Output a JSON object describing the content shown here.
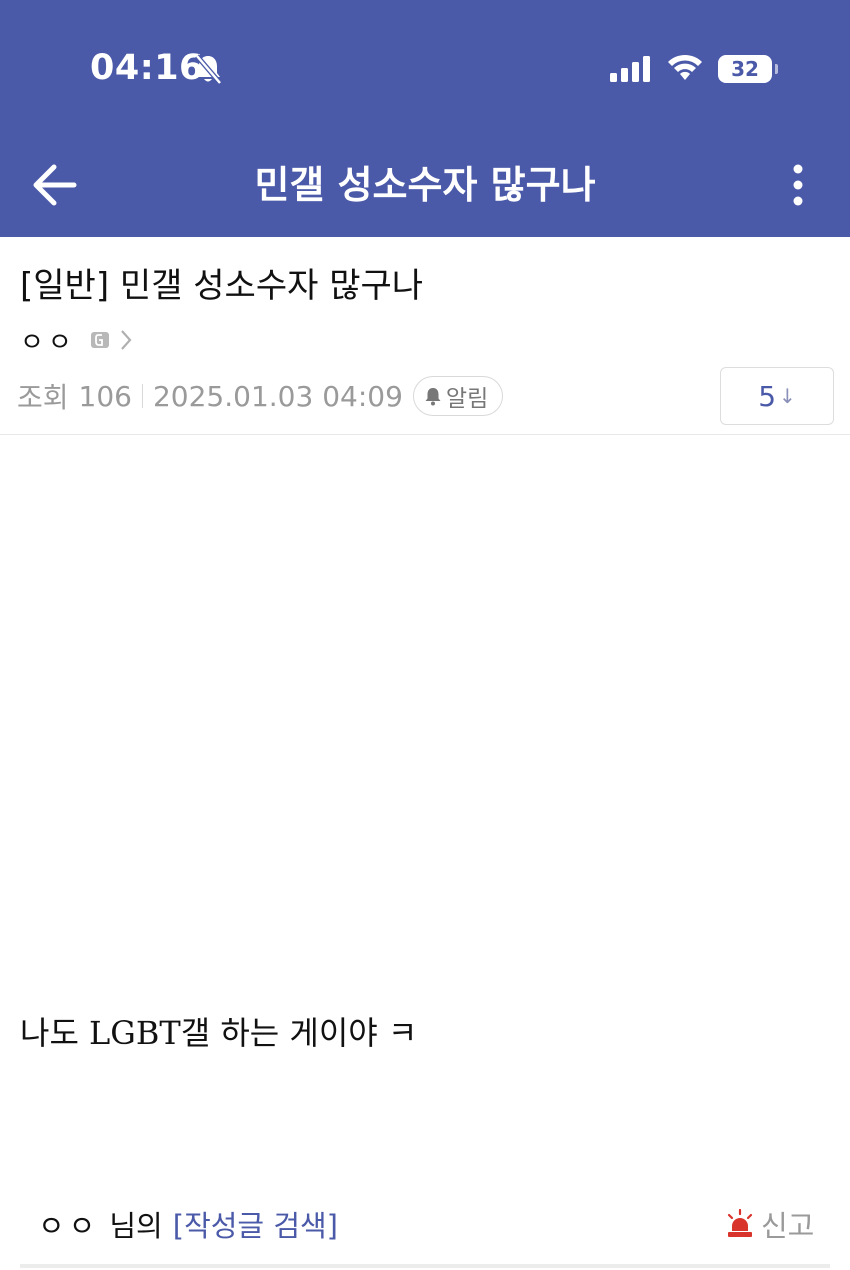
{
  "status_bar": {
    "time": "04:16",
    "battery_level": "32",
    "icons": [
      "bell-slash-icon",
      "cellular-signal-icon",
      "wifi-icon",
      "battery-icon"
    ]
  },
  "nav": {
    "title": "민갤 성소수자 많구나",
    "icons": [
      "back-arrow-icon",
      "more-vertical-icon"
    ]
  },
  "post": {
    "title": "[일반] 민갤 성소수자 많구나",
    "author": "ㅇㅇ",
    "views_label": "조회",
    "views": "106",
    "datetime": "2025.01.03 04:09",
    "alarm_label": "알림",
    "comment_count": "5",
    "comment_arrow": "↓",
    "body": "나도 LGBT갤 하는 게이야 ㅋ"
  },
  "footer": {
    "author": "ㅇㅇ",
    "suffix": "님의",
    "search_link": "[작성글 검색]",
    "report_label": "신고"
  },
  "colors": {
    "header": "#4a59a8",
    "accent": "#4a59a8",
    "muted": "#9a9a9a",
    "report": "#d9342b"
  }
}
